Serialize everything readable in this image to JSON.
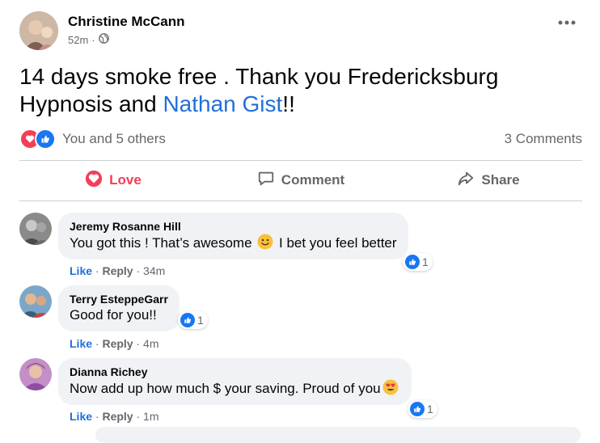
{
  "post": {
    "author": "Christine McCann",
    "time": "52m",
    "separator": "·",
    "text_part1": "14 days smoke free . Thank you Fredericksburg Hypnosis and ",
    "text_link": "Nathan Gist",
    "text_part2": "!!",
    "reactions_text": "You and 5 others",
    "comments_count": "3 Comments"
  },
  "actions": {
    "love": "Love",
    "comment": "Comment",
    "share": "Share"
  },
  "comments": [
    {
      "name": "Jeremy Rosanne Hill",
      "text_before": "You got this ! That’s awesome ",
      "text_after": " I bet you feel better",
      "like": "Like",
      "reply": "Reply",
      "time": "34m",
      "reaction_count": "1"
    },
    {
      "name": "Terry EsteppeGarr",
      "text": "Good for you!!",
      "like": "Like",
      "reply": "Reply",
      "time": "4m",
      "reaction_count": "1"
    },
    {
      "name": "Dianna Richey",
      "text": "Now add up how much $ your saving. Proud of you",
      "like": "Like",
      "reply": "Reply",
      "time": "1m",
      "reaction_count": "1"
    }
  ],
  "colors": {
    "link": "#216fdb",
    "love": "#f33e58",
    "like": "#1877f2",
    "muted": "#65676b",
    "bubble": "#f0f2f5"
  },
  "icons": {
    "post_menu": "more-horizontal-icon",
    "privacy": "globe-icon",
    "love": "heart-icon",
    "comment": "comment-bubble-icon",
    "share": "share-arrow-icon",
    "like": "thumbs-up-icon"
  }
}
